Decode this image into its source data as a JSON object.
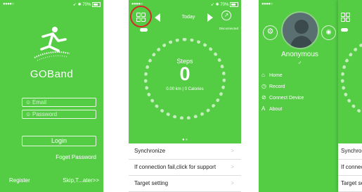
{
  "status_bar": {
    "signal": "●●●●○",
    "battery": "70%",
    "icons": "➹ ✱"
  },
  "login": {
    "app_name": "GOBand",
    "email_placeholder": "Email",
    "password_placeholder": "Password",
    "login_label": "Login",
    "forget_label": "Foget Password",
    "register_label": "Register",
    "skip_label": "Skip,T...ater>>"
  },
  "dashboard": {
    "date_label": "Today",
    "connection_status": "Disconnected",
    "steps_label": "Steps",
    "steps_value": "0",
    "stats_text": "0.00 km | 0 Calories",
    "menu": [
      {
        "label": "Synchronize"
      },
      {
        "label": "If connection fail,click for support"
      },
      {
        "label": "Target setting"
      }
    ]
  },
  "drawer": {
    "user_name": "Anonymous",
    "gender_symbol": "♂",
    "nav": [
      {
        "label": "Home",
        "icon": "home-icon"
      },
      {
        "label": "Record",
        "icon": "record-icon"
      },
      {
        "label": "Connect Device",
        "icon": "connect-device-icon"
      },
      {
        "label": "About",
        "icon": "about-icon"
      }
    ],
    "overlay_rows": [
      {
        "label": "Synchronize"
      },
      {
        "label": "If connection fail,click for support"
      },
      {
        "label": "Target setting"
      }
    ]
  },
  "colors": {
    "brand_green": "#54cd45",
    "highlight_red": "#d42a2a"
  }
}
